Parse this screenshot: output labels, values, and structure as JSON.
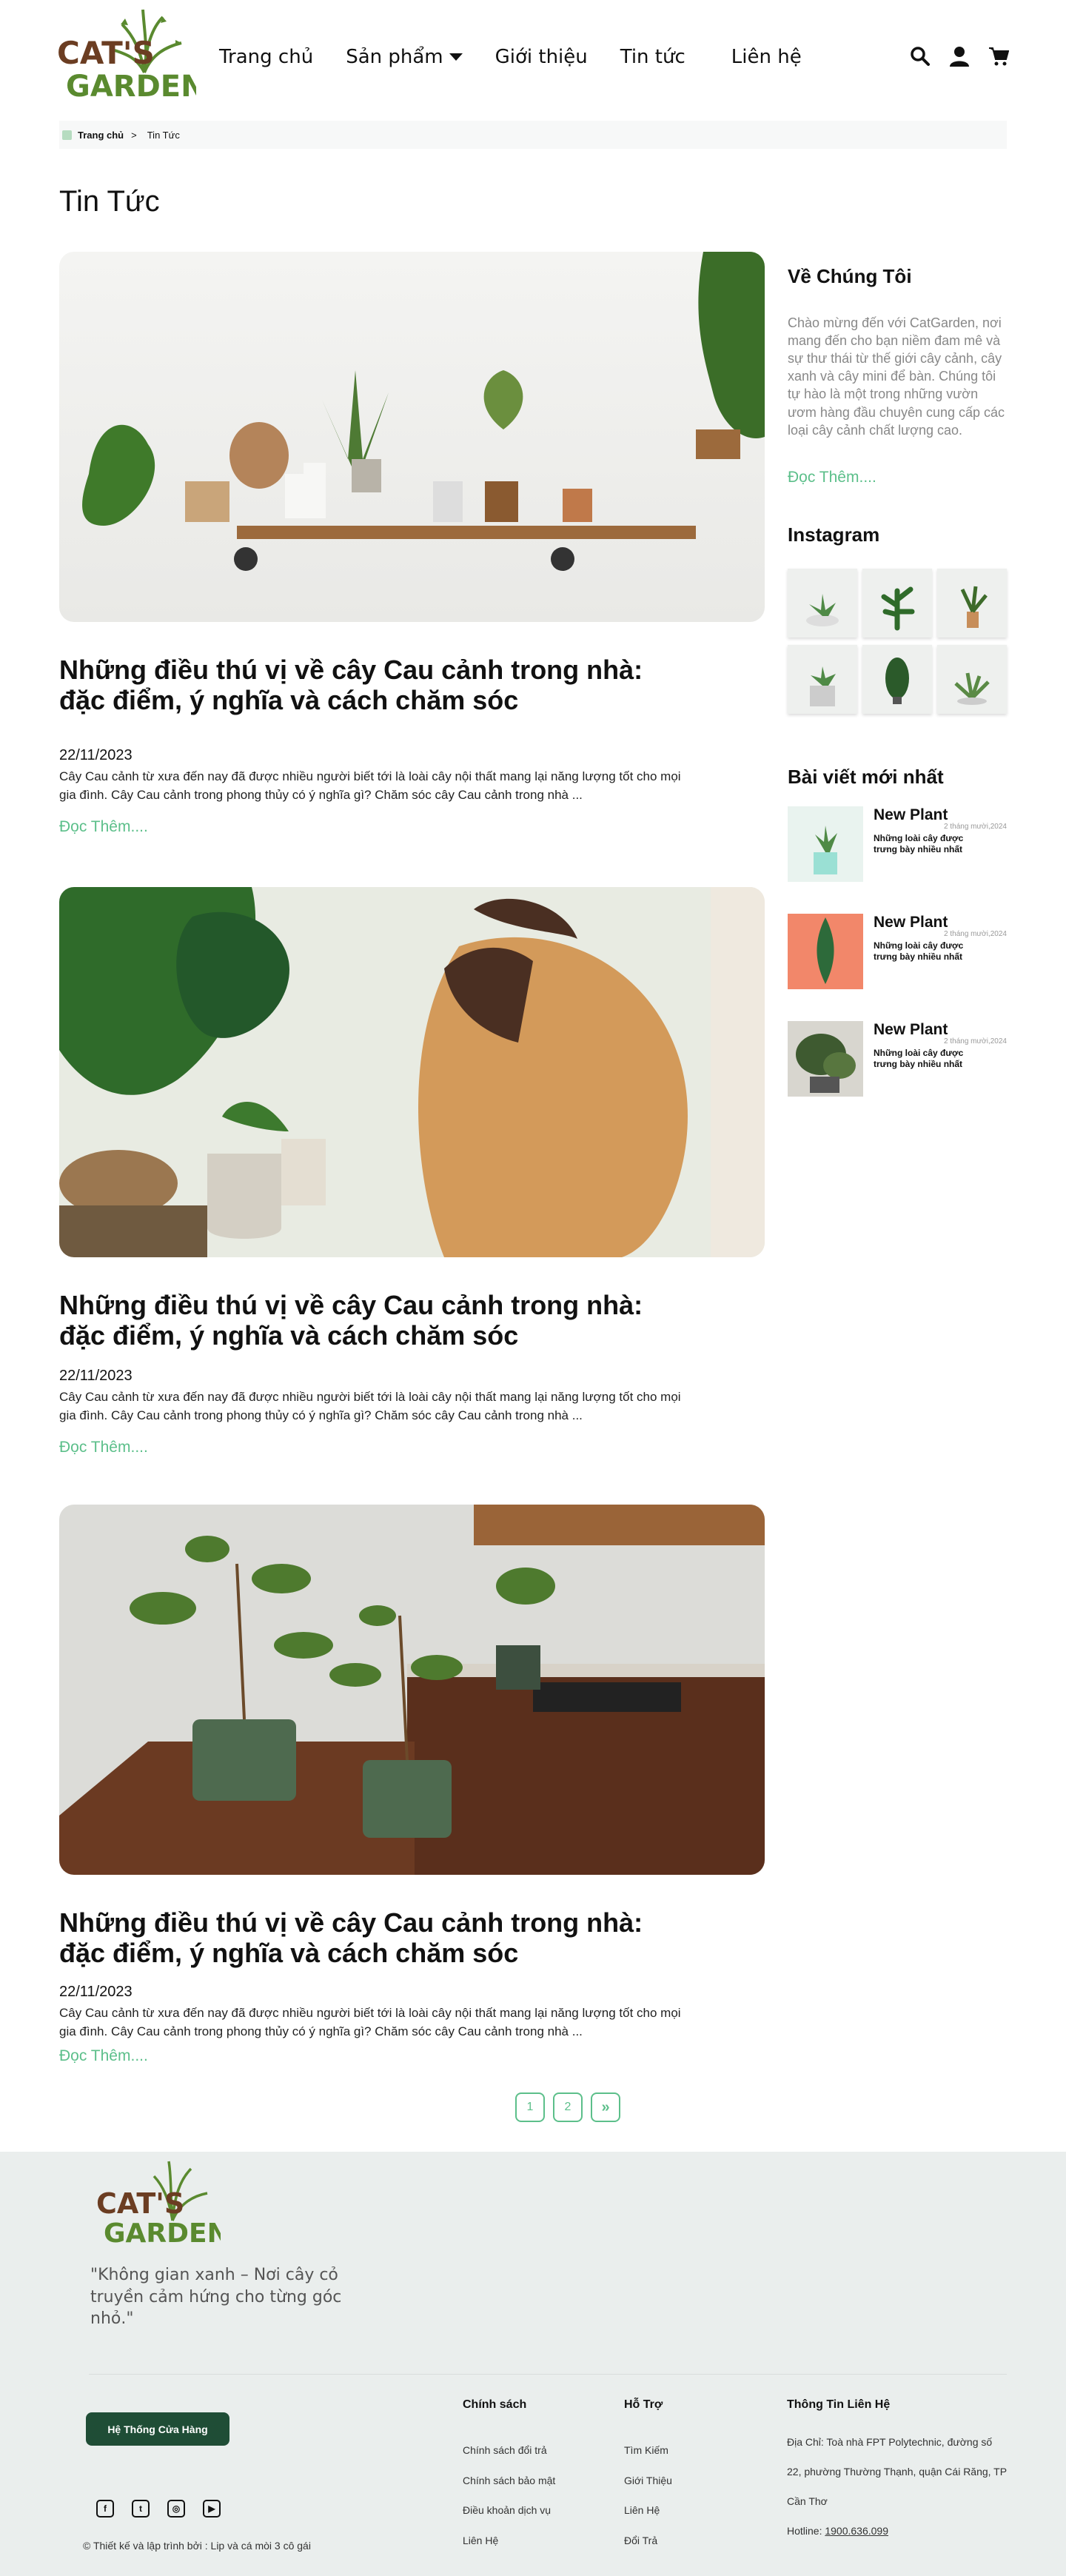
{
  "header": {
    "logo_text_top": "CAT'S",
    "logo_text_bottom": "GARDEN",
    "nav": [
      "Trang chủ",
      "Sản phẩm",
      "Giới thiệu",
      "Tin tức",
      "Liên hệ"
    ]
  },
  "breadcrumb": {
    "home": "Trang chủ",
    "sep": ">",
    "current": "Tin Tức"
  },
  "page_title": "Tin Tức",
  "posts": [
    {
      "title": "Những điều thú vị về cây Cau cảnh trong nhà: đặc điểm, ý nghĩa và cách chăm sóc",
      "date": "22/11/2023",
      "excerpt": "Cây Cau cảnh từ xưa đến nay đã được nhiều người biết tới là loài cây nội thất mang lại năng lượng tốt cho mọi gia đình. Cây Cau cảnh trong phong thủy có ý nghĩa gì? Chăm sóc cây Cau cảnh trong nhà ...",
      "more": "Đọc Thêm...."
    },
    {
      "title": "Những điều thú vị về cây Cau cảnh trong nhà: đặc điểm, ý nghĩa và cách chăm sóc",
      "date": "22/11/2023",
      "excerpt": "Cây Cau cảnh từ xưa đến nay đã được nhiều người biết tới là loài cây nội thất mang lại năng lượng tốt cho mọi gia đình. Cây Cau cảnh trong phong thủy có ý nghĩa gì? Chăm sóc cây Cau cảnh trong nhà ...",
      "more": "Đọc Thêm...."
    },
    {
      "title": "Những điều thú vị về cây Cau cảnh trong nhà: đặc điểm, ý nghĩa và cách chăm sóc",
      "date": "22/11/2023",
      "excerpt": "Cây Cau cảnh từ xưa đến nay đã được nhiều người biết tới là loài cây nội thất mang lại năng lượng tốt cho mọi gia đình. Cây Cau cảnh trong phong thủy có ý nghĩa gì? Chăm sóc cây Cau cảnh trong nhà ...",
      "more": "Đọc Thêm...."
    }
  ],
  "sidebar": {
    "about_title": "Về Chúng Tôi",
    "about_text": "Chào mừng đến với CatGarden, nơi mang đến cho bạn niềm đam mê và sự thư thái từ thế giới cây cảnh, cây xanh và cây mini để bàn. Chúng tôi tự hào là một trong những vườn ươm hàng đầu chuyên cung cấp các loại cây cảnh chất lượng cao.",
    "about_more": "Đọc Thêm....",
    "instagram_title": "Instagram",
    "latest_title": "Bài viết mới nhất",
    "latest": [
      {
        "title": "New Plant",
        "desc": "Những loài cây được trưng bày nhiều nhất",
        "date": "2 tháng mười,2024"
      },
      {
        "title": "New Plant",
        "desc": "Những loài cây được trưng bày nhiều nhất",
        "date": "2 tháng mười,2024"
      },
      {
        "title": "New Plant",
        "desc": "Những loài cây được trưng bày nhiều nhất",
        "date": "2 tháng mười,2024"
      }
    ]
  },
  "pagination": [
    "1",
    "2",
    "»"
  ],
  "footer": {
    "quote": "\"Không gian xanh – Nơi cây cỏ truyền cảm hứng cho từng góc nhỏ.\"",
    "store_button": "Hệ Thống Cửa Hàng",
    "copyright": "© Thiết kế và lập trình bởi : Lip và cá mòi 3 cô gái",
    "policy_title": "Chính sách",
    "policy_links": [
      "Chính sách đổi trả",
      "Chính sách bảo mật",
      "Điều khoản dịch vụ",
      "Liên Hệ"
    ],
    "support_title": "Hỗ Trợ",
    "support_links": [
      "Tìm Kiếm",
      "Giới Thiệu",
      "Liên Hệ",
      "Đổi Trả"
    ],
    "contact_title": "Thông Tin Liên Hệ",
    "contact_address": "Địa Chỉ: Toà nhà FPT Polytechnic, đường số 22, phường Thường Thạnh, quận Cái Răng, TP Cần Thơ",
    "contact_hotline_label": "Hotline: ",
    "contact_hotline": "1900.636.099"
  },
  "colors": {
    "accent": "#5cbf8a",
    "dark_green": "#1f4d36",
    "footer_bg": "#eaeeed",
    "logo_brown": "#6b3d22",
    "logo_green": "#5a8a2f"
  },
  "icons": [
    "search-icon",
    "user-icon",
    "cart-icon",
    "facebook-icon",
    "twitter-icon",
    "instagram-icon",
    "youtube-icon"
  ]
}
